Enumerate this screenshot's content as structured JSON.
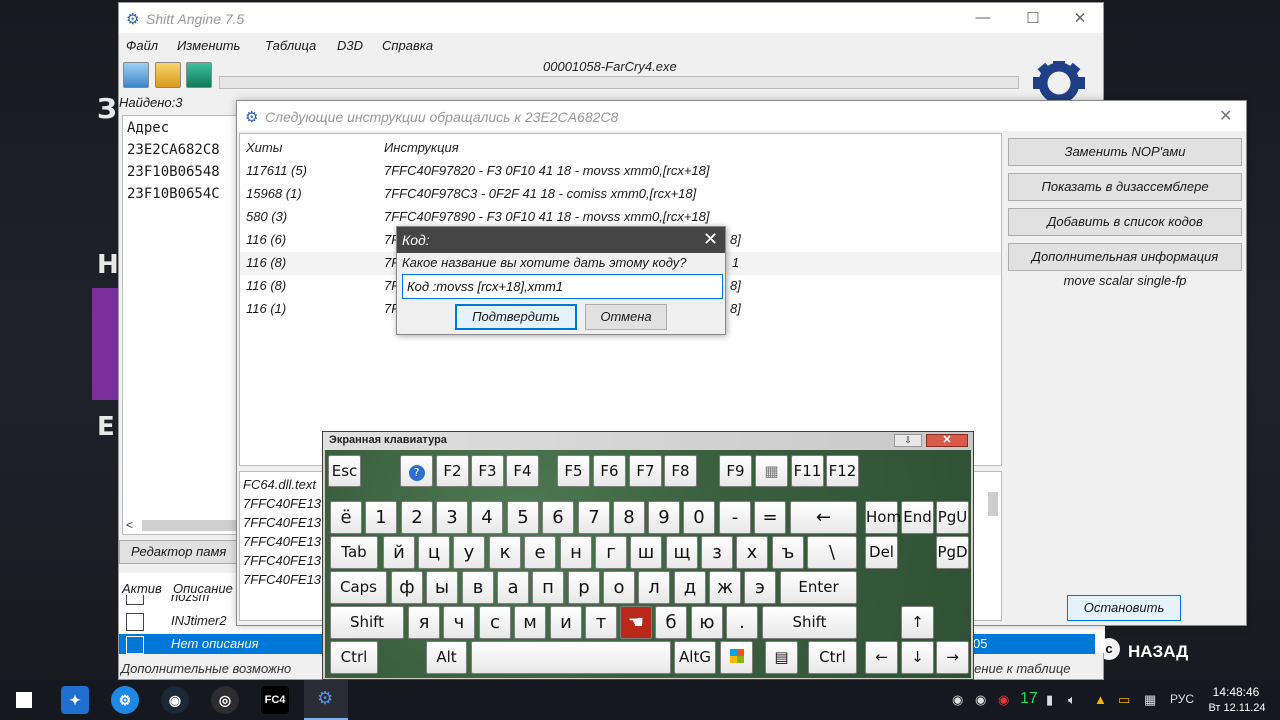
{
  "background": {
    "left_texts": [
      "З",
      "Н",
      "Е"
    ],
    "nazad_icon": "с",
    "nazad_label": "НАЗАД"
  },
  "main_window": {
    "title": "Shitt Angine 7.5",
    "menu": [
      "Файл",
      "Изменить",
      "Таблица",
      "D3D",
      "Справка"
    ],
    "process": "00001058-FarCry4.exe",
    "found": "Найдено:3",
    "address_header": "Адрес",
    "addresses": [
      "23E2CA682C8",
      "23F10B06548",
      "23F10B0654C"
    ],
    "memory_view_button": "Редактор памя",
    "table_columns": [
      "Актив",
      "Описание"
    ],
    "table_rows": [
      {
        "description": "nozsm",
        "selected": false
      },
      {
        "description": "INJtimer2",
        "selected": false
      },
      {
        "description": "Нет описания",
        "selected": true
      }
    ],
    "selected_value": "05",
    "status_left": "Дополнительные возможно",
    "status_right": "нение к таблице"
  },
  "instructions_window": {
    "title": "Следующие инструкции обращались к 23E2CA682C8",
    "col_hits": "Хиты",
    "col_instruction": "Инструкция",
    "rows": [
      {
        "hits": "117611 (5)",
        "instruction": "7FFC40F97820 - F3 0F10 41 18  - movss xmm0,[rcx+18]"
      },
      {
        "hits": "15968 (1)",
        "instruction": "7FFC40F978C3 - 0F2F 41 18  - comiss xmm0,[rcx+18]"
      },
      {
        "hits": "580 (3)",
        "instruction": "7FFC40F97890 - F3 0F10 41 18  - movss xmm0,[rcx+18]"
      },
      {
        "hits": "116 (6)",
        "instruction": "7F",
        "tail": "8]"
      },
      {
        "hits": "116 (8)",
        "instruction": "7F",
        "tail": "1"
      },
      {
        "hits": "116 (8)",
        "instruction": "7F",
        "tail": "8]"
      },
      {
        "hits": "116 (1)",
        "instruction": "7F",
        "tail": "8]"
      }
    ],
    "buttons": [
      "Заменить NOP'ами",
      "Показать в дизассемблере",
      "Добавить в список кодов",
      "Дополнительная информация"
    ],
    "info": "move scalar single-fp",
    "lower_rows": [
      "FC64.dll.text",
      "7FFC40FE13",
      "7FFC40FE13",
      "7FFC40FE13",
      "7FFC40FE13",
      "7FFC40FE13"
    ],
    "stop_button": "Остановить"
  },
  "code_dialog": {
    "title": "Код:",
    "prompt": "Какое название вы хотите дать этому коду?",
    "value": "Код :movss [rcx+18],xmm1",
    "confirm": "Подтвердить",
    "cancel": "Отмена"
  },
  "osk": {
    "title": "Экранная клавиатура",
    "row_f": [
      "Esc",
      "?",
      "F2",
      "F3",
      "F4",
      "F5",
      "F6",
      "F7",
      "F8",
      "F9",
      "▦",
      "F11",
      "F12"
    ],
    "row_num": [
      "ё",
      "1",
      "2",
      "3",
      "4",
      "5",
      "6",
      "7",
      "8",
      "9",
      "0",
      "-",
      "=",
      "←"
    ],
    "row_tab": [
      "Tab",
      "й",
      "ц",
      "у",
      "к",
      "е",
      "н",
      "г",
      "ш",
      "щ",
      "з",
      "х",
      "ъ",
      "\\"
    ],
    "row_caps": [
      "Caps",
      "ф",
      "ы",
      "в",
      "а",
      "п",
      "р",
      "о",
      "л",
      "д",
      "ж",
      "э",
      "Enter"
    ],
    "row_shift": [
      "Shift",
      "я",
      "ч",
      "с",
      "м",
      "и",
      "т",
      "",
      "б",
      "ю",
      ".",
      "Shift"
    ],
    "row_ctrl": [
      "Ctrl",
      "Alt",
      "",
      "AltG",
      "",
      "▤",
      "Ctrl"
    ],
    "nav": [
      "Hom",
      "End",
      "PgU",
      "Del",
      "PgD"
    ],
    "arrows": [
      "↑",
      "←",
      "↓",
      "→"
    ]
  },
  "taskbar": {
    "time": "14:48:46",
    "date": "Вт 12.11.24",
    "lang": "РУС",
    "notif_count": "17",
    "apps": [
      "windows-start",
      "app-1",
      "app-2",
      "steam",
      "app-4",
      "fc4",
      "cheat-engine"
    ]
  }
}
